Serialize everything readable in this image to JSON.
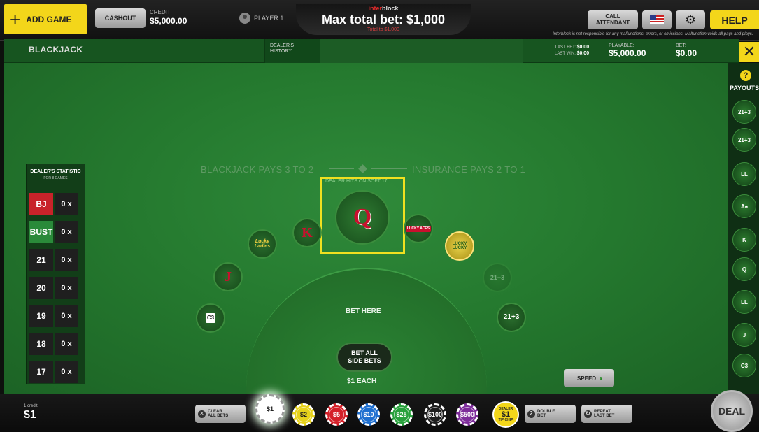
{
  "top": {
    "add_game": "ADD GAME",
    "cashout": "CASHOUT",
    "credit_label": "CREDIT",
    "credit_value": "$5,000.00",
    "player": "PLAYER 1",
    "logo_a": "inter",
    "logo_b": "block",
    "max_bet": "Max total bet: $1,000",
    "max_bet_sub": "Total to $1,000",
    "call_attendant_1": "CALL",
    "call_attendant_2": "ATTENDANT",
    "help": "HELP",
    "disclaimer": "Interblock is not responsible for any malfunctions, errors, or omissions. Malfunction voids all pays and plays."
  },
  "info": {
    "game": "BLACKJACK",
    "dealer_history_1": "DEALER'S",
    "dealer_history_2": "HISTORY",
    "last_bet_label": "LAST BET:",
    "last_bet": "$0.00",
    "last_win_label": "LAST WIN:",
    "last_win": "$0.00",
    "playable_label": "PLAYABLE:",
    "playable": "$5,000.00",
    "bet_label": "BET:",
    "bet": "$0.00",
    "close": "✕"
  },
  "payouts": {
    "help": "?",
    "label": "PAYOUTS",
    "items": [
      {
        "icon": "21+3-icon",
        "text": "21+3"
      },
      {
        "icon": "21+3-alt-icon",
        "text": "21+3"
      },
      {
        "icon": "lucky-lucky-icon",
        "text": "LL"
      },
      {
        "icon": "lucky-aces-icon",
        "text": "A♠"
      },
      {
        "icon": "king-icon",
        "text": "K"
      },
      {
        "icon": "queen-icon",
        "text": "Q"
      },
      {
        "icon": "lucky-ladies-icon",
        "text": "LL"
      },
      {
        "icon": "jack-icon",
        "text": "J"
      },
      {
        "icon": "c3-icon",
        "text": "C3"
      }
    ]
  },
  "stats": {
    "title": "DEALER'S STATISTIC",
    "subtitle": "FOR 8 GAMES",
    "rows": [
      {
        "key": "BJ",
        "value": "0 x",
        "color": "#c8232a"
      },
      {
        "key": "BUST",
        "value": "0 x",
        "color": "#2a8a3a"
      },
      {
        "key": "21",
        "value": "0 x",
        "color": "#1f1f1f"
      },
      {
        "key": "20",
        "value": "0 x",
        "color": "#1f1f1f"
      },
      {
        "key": "19",
        "value": "0 x",
        "color": "#1f1f1f"
      },
      {
        "key": "18",
        "value": "0 x",
        "color": "#1f1f1f"
      },
      {
        "key": "17",
        "value": "0 x",
        "color": "#1f1f1f"
      }
    ]
  },
  "table": {
    "blackjack_pays": "BLACKJACK PAYS 3 TO 2",
    "insurance_pays": "INSURANCE PAYS 2 TO 1",
    "dealer_hits": "DEALER HITS ON SOFT 17",
    "center_card": "Q",
    "spots": {
      "king": "K",
      "lucky_ladies": "Lucky Ladies",
      "jack": "J",
      "c3": "C3",
      "lucky_aces": "LUCKY ACES",
      "lucky_lucky": "LUCKY LUCKY",
      "ghost_21": "21+3",
      "side_21": "21+3"
    },
    "bet_here": "BET HERE",
    "bet_all_1": "BET ALL",
    "bet_all_2": "SIDE BETS",
    "each": "$1 EACH",
    "speed": "SPEED",
    "speed_arrows": "›››"
  },
  "bottom": {
    "credit_label": "1 credit:",
    "credit_value": "$1",
    "clear_1": "CLEAR",
    "clear_2": "ALL BETS",
    "chips": [
      {
        "label": "$1",
        "color": "#ffffff",
        "text": "#222222",
        "selected": true
      },
      {
        "label": "$2",
        "color": "#e7d21b",
        "text": "#222222"
      },
      {
        "label": "$5",
        "color": "#d52029",
        "text": "#ffffff"
      },
      {
        "label": "$10",
        "color": "#1e6fd0",
        "text": "#ffffff"
      },
      {
        "label": "$25",
        "color": "#27a03b",
        "text": "#ffffff"
      },
      {
        "label": "$100",
        "color": "#1d1d1d",
        "text": "#ffffff"
      },
      {
        "label": "$500",
        "color": "#7d2c9a",
        "text": "#ffffff"
      }
    ],
    "tip_1": "DEALER",
    "tip_2": "$1",
    "tip_3": "TIP CHIP",
    "double_1": "DOUBLE",
    "double_2": "BET",
    "repeat_1": "REPEAT",
    "repeat_2": "LAST BET",
    "deal": "DEAL"
  }
}
